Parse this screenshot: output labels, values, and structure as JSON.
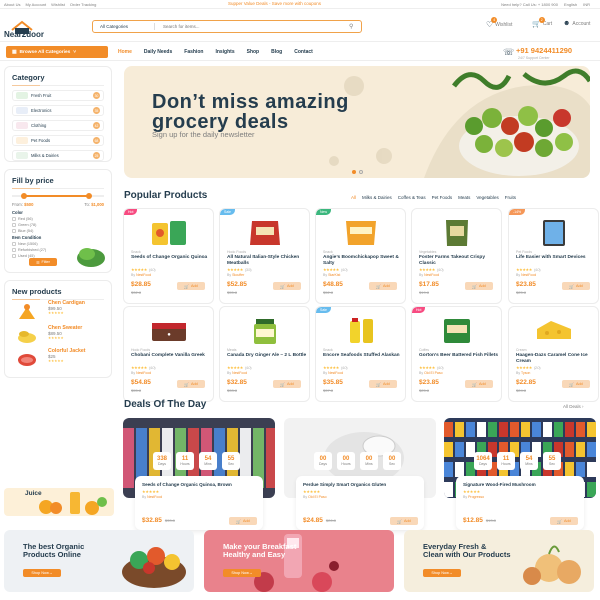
{
  "topbar": {
    "links": [
      "About Us",
      "My Account",
      "Wishlist",
      "Order Tracking"
    ],
    "announcement": "Supper Value Deals - Save more with coupons",
    "help": "Need help? Call Us: + 1800 900",
    "language": "English",
    "currency": "INR"
  },
  "header": {
    "logo_text": "Near2door",
    "category_select": "All Categories",
    "search_placeholder": "Search for items...",
    "wishlist_label": "Wishlist",
    "wishlist_count": "4",
    "cart_label": "Cart",
    "cart_count": "2",
    "account_label": "Account"
  },
  "nav": {
    "browse_label": "Browse All Categories",
    "links": [
      "Home",
      "Daily Needs",
      "Fashion",
      "Insights",
      "Shop",
      "Blog",
      "Contact"
    ],
    "phone": "+91 9424411290",
    "phone_sub": "24/7 Support Center"
  },
  "sidebar": {
    "category_title": "Category",
    "categories": [
      {
        "label": "Fresh Fruit",
        "count": "30"
      },
      {
        "label": "Electronics",
        "count": "35"
      },
      {
        "label": "Clothing",
        "count": "42"
      },
      {
        "label": "Pet Foods",
        "count": "68"
      },
      {
        "label": "Milks & Dairies",
        "count": "25"
      }
    ],
    "filter_title": "Fill by price",
    "price_from_label": "From:",
    "price_from": "$500",
    "price_to_label": "To:",
    "price_to": "$1,000",
    "color_label": "Color",
    "colors": [
      "Red (56)",
      "Green (78)",
      "Blue (54)"
    ],
    "condition_label": "Item Condition",
    "conditions": [
      "New (1506)",
      "Refurbished (27)",
      "Used (45)"
    ],
    "filter_button": "Filter",
    "new_products_title": "New products",
    "new_products": [
      {
        "name": "Chen Cardigan",
        "price": "$99.50"
      },
      {
        "name": "Chen Sweater",
        "price": "$89.50"
      },
      {
        "name": "Colorful Jacket",
        "price": "$25"
      }
    ],
    "juice_label": "Juice"
  },
  "banner": {
    "headline_line1": "Don’t miss amazing",
    "headline_line2": "grocery deals",
    "subtext": "Sign up for the daily newsletter"
  },
  "popular": {
    "title": "Popular Products",
    "tabs": [
      "All",
      "Milks & Dairies",
      "Coffes & Teas",
      "Pet Foods",
      "Meats",
      "Vegetables",
      "Fruits"
    ],
    "products": [
      {
        "tag": "Hot",
        "tag_color": "#f74b81",
        "category": "Snack",
        "name": "Seeds of Change Organic Quinoa",
        "rating": "(4.0)",
        "by": "NestFood",
        "price": "$28.85",
        "old": "$32.8",
        "img": "bag-yellow"
      },
      {
        "tag": "Sale",
        "tag_color": "#67bcee",
        "category": "Hodo Foods",
        "name": "All Natural Italian-Style Chicken Meatballs",
        "rating": "(3.5)",
        "by": "Stouffer",
        "price": "$52.85",
        "old": "$55.8",
        "img": "bag-red"
      },
      {
        "tag": "New",
        "tag_color": "#3bb77e",
        "category": "Snack",
        "name": "Angie’s Boomchickapop Sweet & Salty",
        "rating": "(4.0)",
        "by": "StarKist",
        "price": "$48.85",
        "old": "$52.8",
        "img": "bag-orange"
      },
      {
        "tag": "",
        "tag_color": "",
        "category": "Vegetables",
        "name": "Foster Farms Takeout Crispy Classic",
        "rating": "(4.0)",
        "by": "NestFood",
        "price": "$17.85",
        "old": "$19.8",
        "img": "bag-green"
      },
      {
        "tag": "-14%",
        "tag_color": "#f59758",
        "category": "Pet Foods",
        "name": "Life Easier with Smart Devices",
        "rating": "(4.0)",
        "by": "NestFood",
        "price": "$23.85",
        "old": "$25.8",
        "img": "tablet"
      },
      {
        "tag": "",
        "tag_color": "",
        "category": "Hodo Foods",
        "name": "Chobani Complete Vanilla Greek",
        "rating": "(4.0)",
        "by": "NestFood",
        "price": "$54.85",
        "old": "$55.8",
        "img": "muffin"
      },
      {
        "tag": "",
        "tag_color": "",
        "category": "Meats",
        "name": "Canada Dry Ginger Ale – 2 L Bottle",
        "rating": "(4.0)",
        "by": "NestFood",
        "price": "$32.85",
        "old": "$33.8",
        "img": "jar-green"
      },
      {
        "tag": "Sale",
        "tag_color": "#67bcee",
        "category": "Snack",
        "name": "Encore Seafoods Stuffed Alaskan",
        "rating": "(4.0)",
        "by": "NestFood",
        "price": "$35.85",
        "old": "$37.8",
        "img": "bottles"
      },
      {
        "tag": "Hot",
        "tag_color": "#f74b81",
        "category": "Coffes",
        "name": "Gorton’s Beer Battered Fish Fillets",
        "rating": "(4.0)",
        "by": "Old El Paso",
        "price": "$23.85",
        "old": "$25.8",
        "img": "box-green"
      },
      {
        "tag": "",
        "tag_color": "",
        "category": "Cream",
        "name": "Haagen-Dazs Caramel Cone Ice Cream",
        "rating": "(2.0)",
        "by": "Tyson",
        "price": "$22.85",
        "old": "$24.8",
        "img": "cheese"
      }
    ],
    "add_label": "Add"
  },
  "deals": {
    "title": "Deals Of The Day",
    "all_link": "All Deals",
    "timer_units": [
      "Days",
      "Hours",
      "Mins",
      "Sec"
    ],
    "items": [
      {
        "name": "Seeds of Change Organic Quinoa, Brown",
        "by": "NestFood",
        "price": "$32.85",
        "old": "$33.8",
        "timer": [
          "338",
          "11",
          "54",
          "55"
        ]
      },
      {
        "name": "Perdue Simply Smart Organics Gluten",
        "by": "Old El Paso",
        "price": "$24.85",
        "old": "$26.8",
        "timer": [
          "00",
          "00",
          "00",
          "00"
        ]
      },
      {
        "name": "Signature Wood-Fired Mushroom",
        "by": "Progresso",
        "price": "$12.85",
        "old": "$13.8",
        "timer": [
          "1064",
          "11",
          "54",
          "55"
        ]
      }
    ]
  },
  "promos": [
    {
      "line1": "The best Organic",
      "line2": "Products Online",
      "button": "Shop Now",
      "bg": "#eef1f4"
    },
    {
      "line1": "Make your Breakfast",
      "line2": "Healthy and Easy",
      "button": "Shop Now",
      "bg": "#e9828c"
    },
    {
      "line1": "Everyday Fresh &",
      "line2": "Clean with Our Products",
      "button": "Shop Now",
      "bg": "#f5eedd"
    }
  ],
  "colors": {
    "accent": "#f28c28",
    "heading": "#253d4e",
    "muted": "#7e7e7e"
  }
}
